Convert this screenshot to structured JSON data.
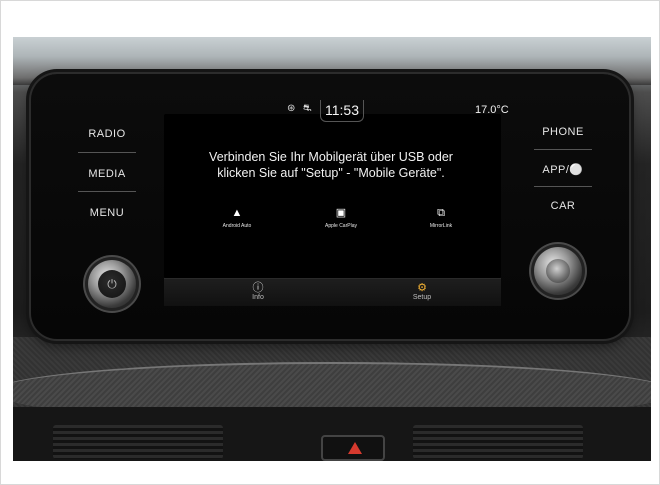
{
  "left_buttons": [
    {
      "label": "RADIO"
    },
    {
      "label": "MEDIA"
    },
    {
      "label": "MENU"
    }
  ],
  "right_buttons": [
    {
      "label": "PHONE"
    },
    {
      "label": "APP/⚪"
    },
    {
      "label": "CAR"
    }
  ],
  "status_bar": {
    "time": "11:53",
    "temperature": "17.0°C"
  },
  "message": {
    "line1": "Verbinden Sie Ihr Mobilgerät über USB oder",
    "line2": "klicken Sie auf \"Setup\" - \"Mobile Geräte\"."
  },
  "apps": [
    {
      "label": "Android Auto",
      "icon": "android-auto-icon"
    },
    {
      "label": "Apple CarPlay",
      "icon": "apple-carplay-icon"
    },
    {
      "label": "MirrorLink",
      "icon": "mirrorlink-icon"
    }
  ],
  "bottom_bar": {
    "info_label": "Info",
    "setup_label": "Setup"
  },
  "colors": {
    "screen_bg": "#000000",
    "text": "#f2f2f2",
    "accent": "#f2b134"
  }
}
